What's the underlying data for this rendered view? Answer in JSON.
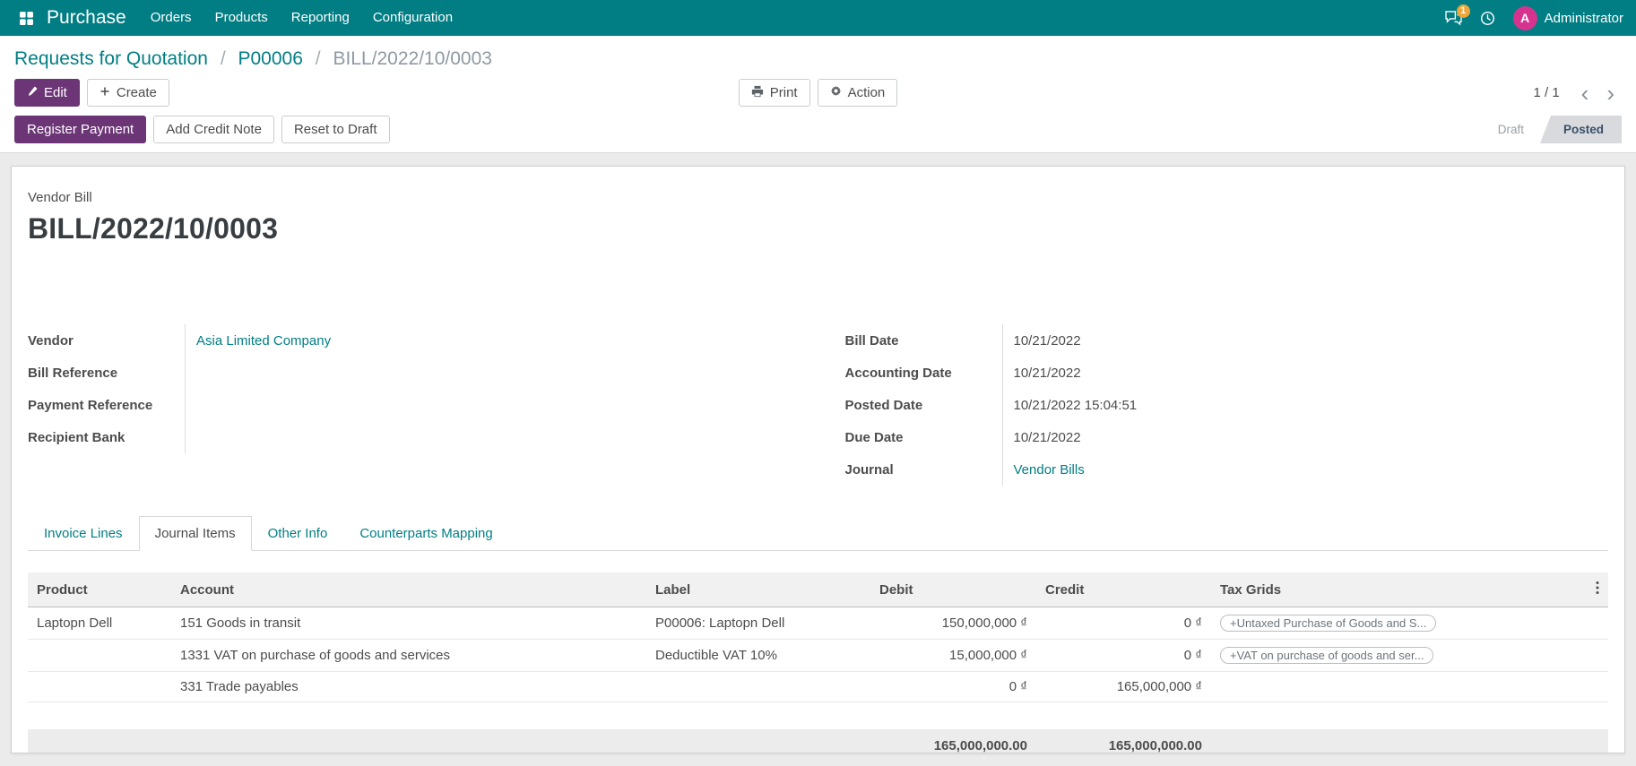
{
  "colors": {
    "navbar_bg": "#017e84",
    "link": "#017e84",
    "primary_button": "#6b3576",
    "avatar_bg": "#d6338f"
  },
  "navbar": {
    "app_name": "Purchase",
    "menu_items": [
      {
        "label": "Orders"
      },
      {
        "label": "Products"
      },
      {
        "label": "Reporting"
      },
      {
        "label": "Configuration"
      }
    ],
    "message_count": "1",
    "avatar_letter": "A",
    "user_name": "Administrator"
  },
  "breadcrumb": {
    "separator": "/",
    "items": [
      {
        "label": "Requests for Quotation"
      },
      {
        "label": "P00006"
      },
      {
        "label": "BILL/2022/10/0003"
      }
    ]
  },
  "control_panel": {
    "edit_label": "Edit",
    "create_label": "Create",
    "print_label": "Print",
    "action_label": "Action",
    "pager_text": "1 / 1",
    "pager_prev_glyph": "‹",
    "pager_next_glyph": "›"
  },
  "statusbar": {
    "register_payment_label": "Register Payment",
    "add_credit_note_label": "Add Credit Note",
    "reset_to_draft_label": "Reset to Draft",
    "states": [
      {
        "label": "Draft"
      },
      {
        "label": "Posted"
      }
    ],
    "active_state": "Posted"
  },
  "sheet": {
    "doc_type_label": "Vendor Bill",
    "title": "BILL/2022/10/0003",
    "fields_left": [
      {
        "label": "Vendor",
        "value": "Asia Limited Company"
      },
      {
        "label": "Bill Reference",
        "value": ""
      },
      {
        "label": "Payment Reference",
        "value": ""
      },
      {
        "label": "Recipient Bank",
        "value": ""
      }
    ],
    "fields_right": [
      {
        "label": "Bill Date",
        "value": "10/21/2022"
      },
      {
        "label": "Accounting Date",
        "value": "10/21/2022"
      },
      {
        "label": "Posted Date",
        "value": "10/21/2022 15:04:51"
      },
      {
        "label": "Due Date",
        "value": "10/21/2022"
      },
      {
        "label": "Journal",
        "value": "Vendor Bills"
      }
    ],
    "tabs": [
      {
        "label": "Invoice Lines"
      },
      {
        "label": "Journal Items"
      },
      {
        "label": "Other Info"
      },
      {
        "label": "Counterparts Mapping"
      }
    ],
    "active_tab": "Journal Items"
  },
  "journal_items": {
    "headers": {
      "product": "Product",
      "account": "Account",
      "label": "Label",
      "debit": "Debit",
      "credit": "Credit",
      "tax_grids": "Tax Grids"
    },
    "rows": [
      {
        "product": "Laptopn Dell",
        "account": "151 Goods in transit",
        "label": "P00006: Laptopn Dell",
        "debit": "150,000,000 ₫",
        "credit": "0 ₫",
        "tax_grid": "+Untaxed Purchase of Goods and S..."
      },
      {
        "product": "",
        "account": "1331 VAT on purchase of goods and services",
        "label": "Deductible VAT 10%",
        "debit": "15,000,000 ₫",
        "credit": "0 ₫",
        "tax_grid": "+VAT on purchase of goods and ser..."
      },
      {
        "product": "",
        "account": "331 Trade payables",
        "label": "",
        "debit": "0 ₫",
        "credit": "165,000,000 ₫",
        "tax_grid": ""
      }
    ],
    "totals": {
      "debit": "165,000,000.00",
      "credit": "165,000,000.00"
    }
  }
}
